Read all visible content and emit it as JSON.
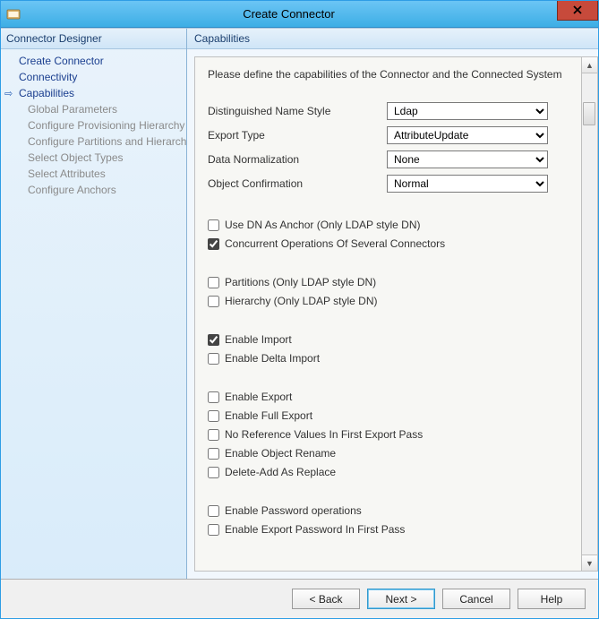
{
  "window": {
    "title": "Create Connector"
  },
  "left": {
    "header": "Connector Designer",
    "items": [
      {
        "label": "Create Connector",
        "type": "section"
      },
      {
        "label": "Connectivity",
        "type": "section"
      },
      {
        "label": "Capabilities",
        "type": "section",
        "current": true
      },
      {
        "label": "Global Parameters",
        "type": "sub"
      },
      {
        "label": "Configure Provisioning Hierarchy",
        "type": "sub"
      },
      {
        "label": "Configure Partitions and Hierarchies",
        "type": "sub"
      },
      {
        "label": "Select Object Types",
        "type": "sub"
      },
      {
        "label": "Select Attributes",
        "type": "sub"
      },
      {
        "label": "Configure Anchors",
        "type": "sub"
      }
    ]
  },
  "right": {
    "header": "Capabilities",
    "intro": "Please define the capabilities of the Connector and the Connected System",
    "dropdowns": [
      {
        "label": "Distinguished Name Style",
        "value": "Ldap"
      },
      {
        "label": "Export Type",
        "value": "AttributeUpdate"
      },
      {
        "label": "Data Normalization",
        "value": "None"
      },
      {
        "label": "Object Confirmation",
        "value": "Normal"
      }
    ],
    "group1": [
      {
        "label": "Use DN As Anchor (Only LDAP style DN)",
        "checked": false
      },
      {
        "label": "Concurrent Operations Of Several Connectors",
        "checked": true
      }
    ],
    "group2": [
      {
        "label": "Partitions (Only LDAP style DN)",
        "checked": false
      },
      {
        "label": "Hierarchy (Only LDAP style DN)",
        "checked": false
      }
    ],
    "group3": [
      {
        "label": "Enable Import",
        "checked": true
      },
      {
        "label": "Enable Delta Import",
        "checked": false
      }
    ],
    "group4": [
      {
        "label": "Enable Export",
        "checked": false
      },
      {
        "label": "Enable Full Export",
        "checked": false
      },
      {
        "label": "No Reference Values In First Export Pass",
        "checked": false
      },
      {
        "label": "Enable Object Rename",
        "checked": false
      },
      {
        "label": "Delete-Add As Replace",
        "checked": false
      }
    ],
    "group5": [
      {
        "label": "Enable Password operations",
        "checked": false
      },
      {
        "label": "Enable Export Password In First Pass",
        "checked": false
      }
    ]
  },
  "buttons": {
    "back": "<  Back",
    "next": "Next  >",
    "cancel": "Cancel",
    "help": "Help"
  }
}
